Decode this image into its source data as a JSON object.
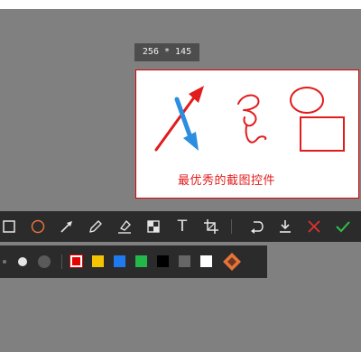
{
  "selection": {
    "size_label": "256 * 145",
    "caption": "最优秀的截图控件"
  },
  "toolbar": {
    "tools": [
      {
        "name": "rectangle-tool",
        "icon": "rectangle-icon"
      },
      {
        "name": "ellipse-tool",
        "icon": "ellipse-icon",
        "color": "#e8733a"
      },
      {
        "name": "arrow-tool",
        "icon": "arrow-icon"
      },
      {
        "name": "pen-tool",
        "icon": "pencil-icon"
      },
      {
        "name": "highlighter-tool",
        "icon": "highlighter-icon"
      },
      {
        "name": "mosaic-tool",
        "icon": "mosaic-icon"
      },
      {
        "name": "text-tool",
        "icon": "text-icon",
        "glyph": "T"
      },
      {
        "name": "crop-tool",
        "icon": "crop-icon"
      },
      {
        "name": "undo-button",
        "icon": "undo-icon"
      },
      {
        "name": "save-button",
        "icon": "download-icon"
      },
      {
        "name": "cancel-button",
        "icon": "close-icon",
        "color": "#e03131"
      },
      {
        "name": "confirm-button",
        "icon": "checkmark-icon",
        "color": "#2fbf4a"
      }
    ]
  },
  "palette": {
    "brush_sizes": [
      "small",
      "medium",
      "large"
    ],
    "colors": [
      "#e60000",
      "#f5c400",
      "#1e7bef",
      "#22b84a",
      "#000000",
      "#666666",
      "#ffffff"
    ],
    "selected_color": "#e60000",
    "custom_color_icon": "color-picker-icon"
  }
}
